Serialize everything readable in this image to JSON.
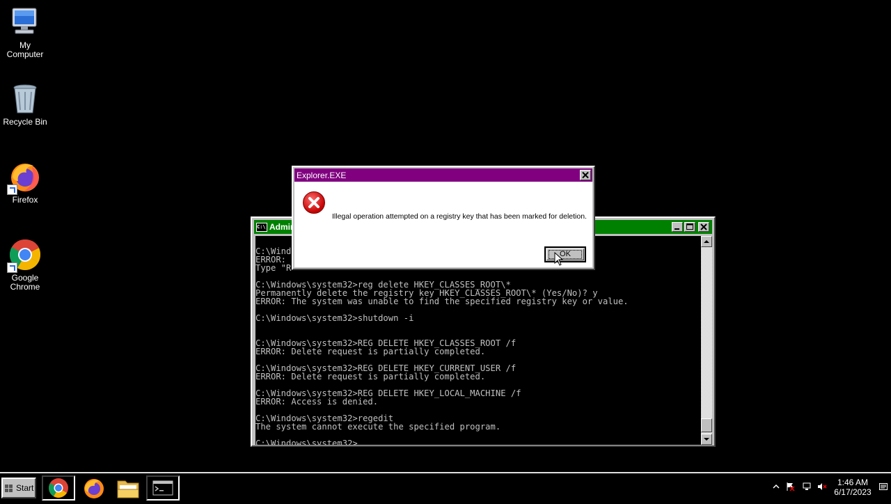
{
  "desktop": {
    "icons": [
      {
        "label_line1": "My",
        "label_line2": "Computer",
        "icon": "my-computer-icon"
      },
      {
        "label_line1": "Recycle Bin",
        "label_line2": "",
        "icon": "recycle-bin-icon"
      },
      {
        "label_line1": "Firefox",
        "label_line2": "",
        "icon": "firefox-icon"
      },
      {
        "label_line1": "Google",
        "label_line2": "Chrome",
        "icon": "chrome-icon"
      }
    ]
  },
  "console": {
    "title": "Admin",
    "title_bar_color": "#008000",
    "lines": [
      "C:\\Windo",
      "ERROR: ",
      "Type \"R",
      "",
      "C:\\Windows\\system32>reg delete HKEY_CLASSES_ROOT\\*",
      "Permanently delete the registry key HKEY_CLASSES_ROOT\\* (Yes/No)? y",
      "ERROR: The system was unable to find the specified registry key or value.",
      "",
      "C:\\Windows\\system32>shutdown -i",
      "",
      "",
      "C:\\Windows\\system32>REG DELETE HKEY_CLASSES_ROOT /f",
      "ERROR: Delete request is partially completed.",
      "",
      "C:\\Windows\\system32>REG DELETE HKEY_CURRENT_USER /f",
      "ERROR: Delete request is partially completed.",
      "",
      "C:\\Windows\\system32>REG DELETE HKEY_LOCAL_MACHINE /f",
      "ERROR: Access is denied.",
      "",
      "C:\\Windows\\system32>regedit",
      "The system cannot execute the specified program.",
      "",
      "C:\\Windows\\system32>"
    ]
  },
  "dialog": {
    "title": "Explorer.EXE",
    "title_bar_color": "#800080",
    "message": "Illegal operation attempted on a registry key that has been marked for deletion.",
    "ok_label": "OK",
    "icon": "error-icon"
  },
  "taskbar": {
    "start_label": "Start",
    "apps": [
      "chrome-icon",
      "firefox-icon",
      "file-explorer-icon",
      "command-prompt-icon"
    ],
    "clock_time": "1:46 AM",
    "clock_date": "6/17/2023"
  }
}
